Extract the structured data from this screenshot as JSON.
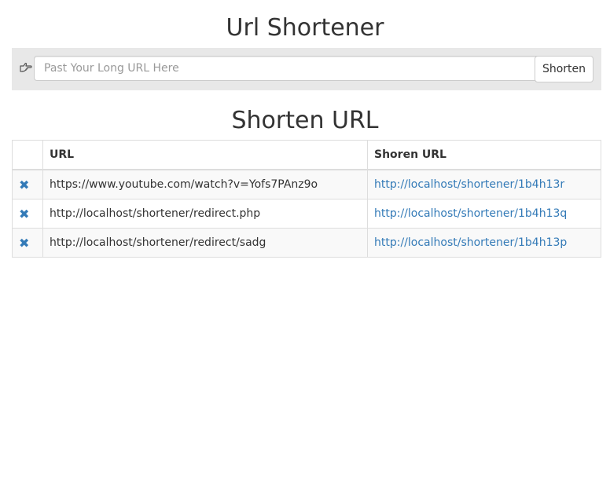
{
  "header": {
    "title": "Url Shortener"
  },
  "form": {
    "icon": "hand-pointing-right-icon",
    "input_placeholder": "Past Your Long URL Here",
    "input_value": "",
    "submit_label": "Shorten"
  },
  "results": {
    "title": "Shorten URL",
    "columns": [
      "",
      "URL",
      "Shoren URL"
    ],
    "rows": [
      {
        "url": "https://www.youtube.com/watch?v=Yofs7PAnz9o",
        "short_url": "http://localhost/shortener/1b4h13r"
      },
      {
        "url": "http://localhost/shortener/redirect.php",
        "short_url": "http://localhost/shortener/1b4h13q"
      },
      {
        "url": "http://localhost/shortener/redirect/sadg",
        "short_url": "http://localhost/shortener/1b4h13p"
      }
    ],
    "delete_icon": "close-icon",
    "delete_glyph": "✖"
  },
  "colors": {
    "link": "#337ab7",
    "form_bar_bg": "#e8e8e8",
    "text": "#333333"
  }
}
